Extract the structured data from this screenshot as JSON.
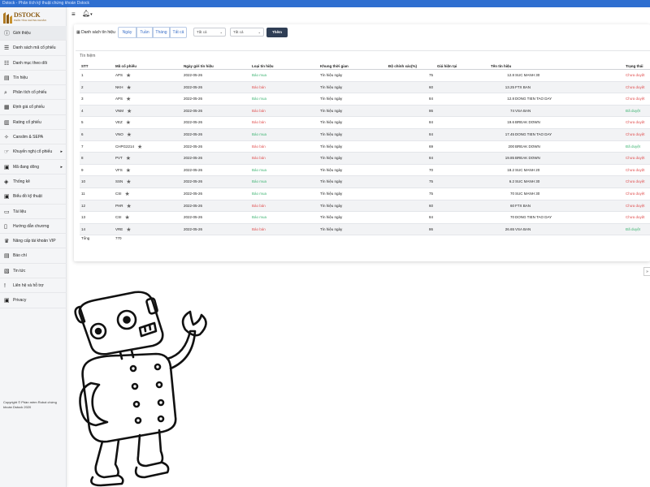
{
  "browser": {
    "title": "Dstock - Phân tích kỹ thuật chứng khoán Dstock"
  },
  "logo": {
    "text": "DSTOCK",
    "subtitle": "PHÂN TÍCH CHỨNG KHOÁN"
  },
  "sidebar": {
    "items": [
      {
        "label": "Giới thiệu",
        "icon": "info-icon"
      },
      {
        "label": "Danh sách mã cổ phiếu",
        "icon": "list-icon"
      },
      {
        "label": "Danh mục theo dõi",
        "icon": "list-check-icon"
      },
      {
        "label": "Tín hiệu",
        "icon": "document-icon"
      },
      {
        "label": "Phân tích cổ phiếu",
        "icon": "search-chart-icon"
      },
      {
        "label": "Định giá cổ phiếu",
        "icon": "calculator-icon"
      },
      {
        "label": "Rating cổ phiếu",
        "icon": "chart-icon"
      },
      {
        "label": "Canslim & SEPA",
        "icon": "bulb-icon"
      },
      {
        "label": "Khuyến nghị cổ phiếu",
        "icon": "hand-icon",
        "has_arrow": true
      },
      {
        "label": "Mã đang dõng",
        "icon": "lock-icon",
        "has_arrow": true
      },
      {
        "label": "Thống kê",
        "icon": "megaphone-icon"
      },
      {
        "label": "Biểu đồ kỹ thuật",
        "icon": "lock-icon"
      },
      {
        "label": "Tài liệu",
        "icon": "folder-icon"
      },
      {
        "label": "Hướng dẫn chương",
        "icon": "book-icon"
      },
      {
        "label": "Nâng cấp tài khoản VIP",
        "icon": "crown-icon"
      },
      {
        "label": "Báo chí",
        "icon": "newspaper-icon"
      },
      {
        "label": "Tin tức",
        "icon": "news-icon"
      },
      {
        "label": "Liên hệ và hỗ trợ",
        "icon": "exclamation-icon"
      },
      {
        "label": "Privacy",
        "icon": "lock-icon"
      }
    ],
    "copyright": "Copyright © Phần mềm Robot chứng khoán Dstock 2020"
  },
  "toolbar": {
    "title": "Danh sách tín hiệu",
    "periods": [
      "Ngày",
      "Tuần",
      "Tháng",
      "Tất cả"
    ],
    "select1": "Tất cả",
    "select2": "Tất cả",
    "add_label": "Thêm"
  },
  "table": {
    "section_title": "Tín hiệm",
    "headers": {
      "stt": "STT",
      "ma": "Mã cổ phiếu",
      "ngay": "Ngày gửi tín hiệu",
      "loai": "Loại tín hiệu",
      "khung": "Khung thời gian",
      "dcx": "Độ chính xác(%)",
      "gia": "Giá hiện tại",
      "ten": "Tên tín hiệu",
      "tt": "Trạng thái"
    },
    "rows": [
      {
        "stt": "1",
        "ma": "APS",
        "ngay": "2022-05-26",
        "loai": "Báo mua",
        "type": "buy",
        "khung": "Tín hiệu ngày",
        "dcx": "75",
        "gia": "12.8",
        "ten": "SUC MANH 30",
        "tt": "Chưa duyệt",
        "done": false
      },
      {
        "stt": "2",
        "ma": "NKH",
        "ngay": "2022-05-26",
        "loai": "Báo bán",
        "type": "sell",
        "khung": "Tín hiệu ngày",
        "dcx": "60",
        "gia": "13.25",
        "ten": "FTX BAN",
        "tt": "Chưa duyệt",
        "done": false
      },
      {
        "stt": "3",
        "ma": "APS",
        "ngay": "2022-05-26",
        "loai": "Báo mua",
        "type": "buy",
        "khung": "Tín hiệu ngày",
        "dcx": "84",
        "gia": "12.8",
        "ten": "DONG TIEN TAO DAY",
        "tt": "Chưa duyệt",
        "done": false
      },
      {
        "stt": "4",
        "ma": "VNM",
        "ngay": "2022-05-26",
        "loai": "Báo bán",
        "type": "sell",
        "khung": "Tín hiệu ngày",
        "dcx": "86",
        "gia": "74",
        "ten": "VSA BAN",
        "tt": "Đã duyệt",
        "done": true
      },
      {
        "stt": "5",
        "ma": "VEZ",
        "ngay": "2022-05-26",
        "loai": "Báo bán",
        "type": "sell",
        "khung": "Tín hiệu ngày",
        "dcx": "84",
        "gia": "19.6",
        "ten": "BREAK DOWN",
        "tt": "Chưa duyệt",
        "done": false
      },
      {
        "stt": "6",
        "ma": "VNO",
        "ngay": "2022-05-26",
        "loai": "Báo mua",
        "type": "buy",
        "khung": "Tín hiệu ngày",
        "dcx": "84",
        "gia": "17.45",
        "ten": "DONG TIEN TAO DAY",
        "tt": "Chưa duyệt",
        "done": false
      },
      {
        "stt": "7",
        "ma": "CHPG2214",
        "ngay": "2022-05-26",
        "loai": "Báo bán",
        "type": "sell",
        "khung": "Tín hiệu ngày",
        "dcx": "69",
        "gia": "200",
        "ten": "BREAK DOWN",
        "tt": "Đã duyệt",
        "done": true
      },
      {
        "stt": "8",
        "ma": "PVT",
        "ngay": "2022-05-26",
        "loai": "Báo bán",
        "type": "sell",
        "khung": "Tín hiệu ngày",
        "dcx": "84",
        "gia": "19.85",
        "ten": "BREAK DOWN",
        "tt": "Chưa duyệt",
        "done": false
      },
      {
        "stt": "9",
        "ma": "VFS",
        "ngay": "2022-05-26",
        "loai": "Báo mua",
        "type": "buy",
        "khung": "Tín hiệu ngày",
        "dcx": "70",
        "gia": "18.2",
        "ten": "SUC MANH 20",
        "tt": "Chưa duyệt",
        "done": false
      },
      {
        "stt": "10",
        "ma": "SSN",
        "ngay": "2022-05-26",
        "loai": "Báo mua",
        "type": "buy",
        "khung": "Tín hiệu ngày",
        "dcx": "75",
        "gia": "6.2",
        "ten": "SUC MANH 30",
        "tt": "Chưa duyệt",
        "done": false
      },
      {
        "stt": "11",
        "ma": "CSI",
        "ngay": "2022-05-26",
        "loai": "Báo mua",
        "type": "buy",
        "khung": "Tín hiệu ngày",
        "dcx": "75",
        "gia": "70",
        "ten": "SUC MANH 30",
        "tt": "Chưa duyệt",
        "done": false
      },
      {
        "stt": "12",
        "ma": "PHR",
        "ngay": "2022-05-26",
        "loai": "Báo bán",
        "type": "sell",
        "khung": "Tín hiệu ngày",
        "dcx": "60",
        "gia": "60",
        "ten": "FTX BAN",
        "tt": "Chưa duyệt",
        "done": false
      },
      {
        "stt": "13",
        "ma": "CSI",
        "ngay": "2022-05-26",
        "loai": "Báo mua",
        "type": "buy",
        "khung": "Tín hiệu ngày",
        "dcx": "84",
        "gia": "70",
        "ten": "DONG TIEN TAO DAY",
        "tt": "Chưa duyệt",
        "done": false
      },
      {
        "stt": "14",
        "ma": "VRE",
        "ngay": "2022-05-26",
        "loai": "Báo bán",
        "type": "sell",
        "khung": "Tín hiệu ngày",
        "dcx": "86",
        "gia": "26.65",
        "ten": "VSA BAN",
        "tt": "Đã duyệt",
        "done": true
      }
    ],
    "total_label": "Tổng",
    "total_value": "770",
    "next_page": "»"
  },
  "colors": {
    "buy": "#3cb371",
    "sell": "#e05050",
    "accent": "#2f6fd0",
    "button": "#2f3e55"
  }
}
